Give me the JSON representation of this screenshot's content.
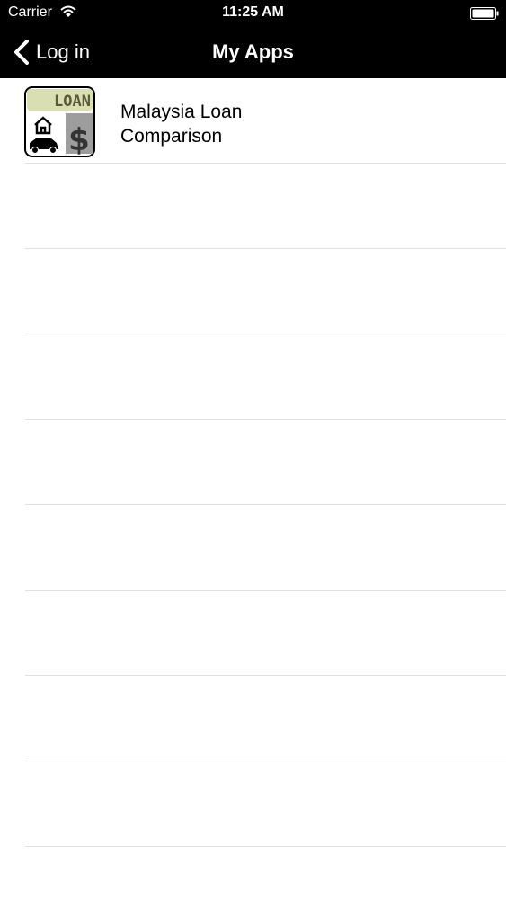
{
  "status_bar": {
    "carrier": "Carrier",
    "time": "11:25 AM"
  },
  "nav": {
    "back_label": "Log in",
    "title": "My Apps"
  },
  "apps": [
    {
      "title_line1": "Malaysia Loan",
      "title_line2": "Comparison",
      "icon_text": "LOAN",
      "icon_symbol": "$"
    }
  ],
  "colors": {
    "bar_background": "#000000",
    "separator": "#e1e1e1"
  }
}
